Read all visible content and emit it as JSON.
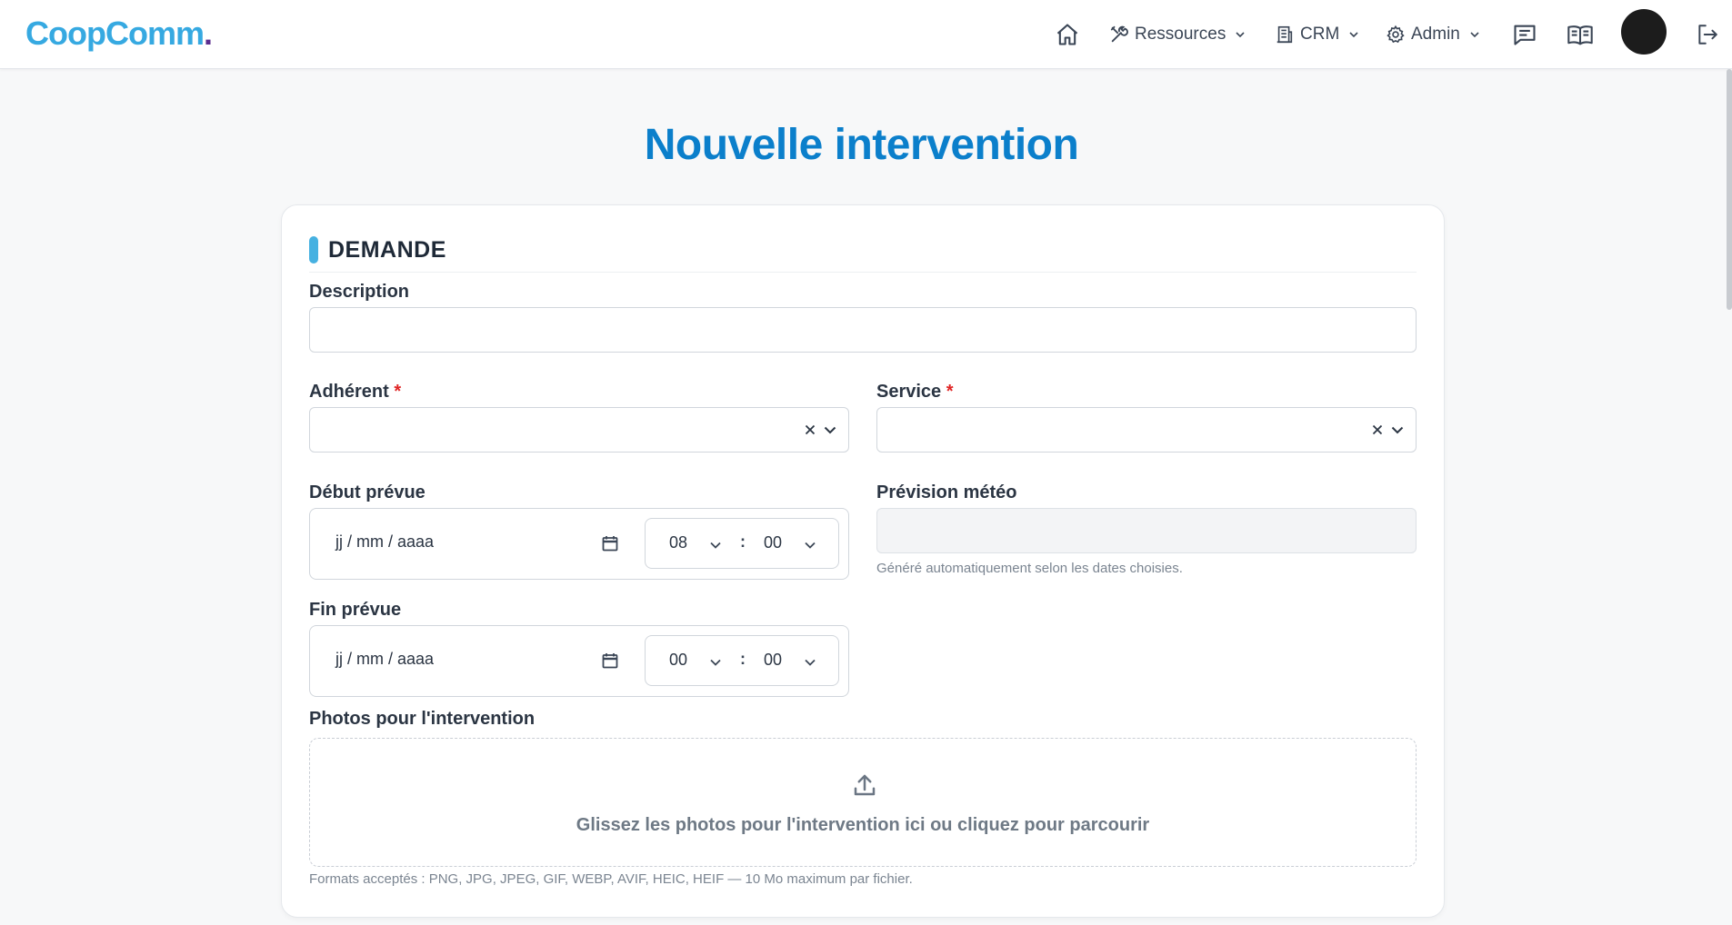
{
  "header": {
    "logo": {
      "part1": "Coop",
      "part2": "op",
      "part3": "Comm",
      "dot": "."
    },
    "nav": {
      "resources_label": "Ressources",
      "crm_label": "CRM",
      "admin_label": "Admin"
    }
  },
  "page": {
    "title": "Nouvelle intervention"
  },
  "form": {
    "section_title": "DEMANDE",
    "description": {
      "label": "Description",
      "value": ""
    },
    "adherent": {
      "label": "Adhérent",
      "required_mark": "*",
      "value": ""
    },
    "service": {
      "label": "Service",
      "required_mark": "*",
      "value": ""
    },
    "debut": {
      "label": "Début prévue",
      "date_placeholder": "jj / mm / aaaa",
      "hour": "08",
      "minute": "00",
      "separator": ":"
    },
    "meteo": {
      "label": "Prévision météo",
      "value": "",
      "help": "Généré automatiquement selon les dates choisies."
    },
    "fin": {
      "label": "Fin prévue",
      "date_placeholder": "jj / mm / aaaa",
      "hour": "00",
      "minute": "00",
      "separator": ":"
    },
    "photos": {
      "label": "Photos pour l'intervention",
      "dropzone_text": "Glissez les photos pour l'intervention ici ou cliquez pour parcourir",
      "help": "Formats acceptés : PNG, JPG, JPEG, GIF, WEBP, AVIF, HEIC, HEIF — 10 Mo maximum par fichier."
    }
  },
  "colors": {
    "brand_blue": "#36a9e1",
    "brand_purple": "#5b2d8e",
    "title_blue": "#0b7fcb",
    "required_red": "#e02424"
  },
  "icons": [
    "home-icon",
    "tools-icon",
    "building-icon",
    "gear-icon",
    "chat-icon",
    "book-icon",
    "logout-icon",
    "calendar-icon",
    "chevron-down-icon",
    "clear-icon",
    "upload-icon"
  ]
}
